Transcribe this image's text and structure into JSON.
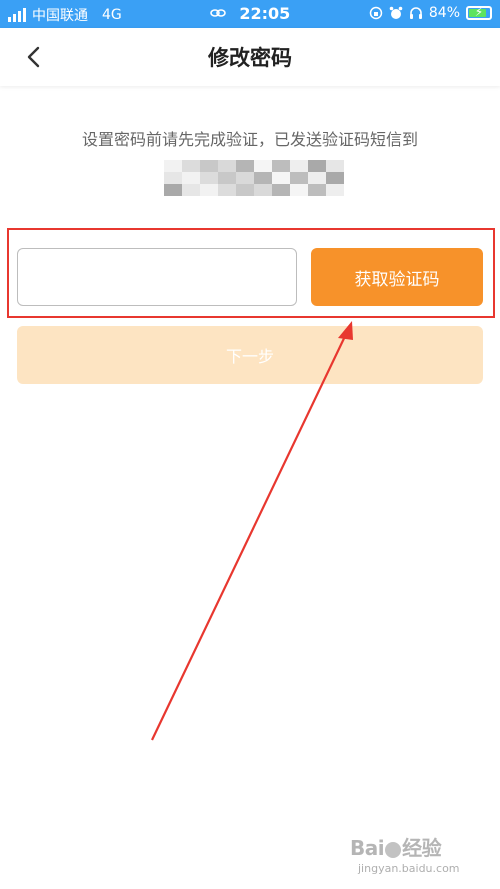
{
  "status_bar": {
    "carrier": "中国联通",
    "network": "4G",
    "time": "22:05",
    "battery": "84%",
    "battery_level": 0.84,
    "icons": [
      "signal-icon",
      "hotspot-icon",
      "lock-rotation-icon",
      "alarm-icon",
      "headphones-icon",
      "battery-icon"
    ]
  },
  "nav": {
    "title": "修改密码",
    "back_icon": "chevron-left-icon"
  },
  "verify": {
    "instruction": "设置密码前请先完成验证，已发送验证码短信到",
    "code_input_value": "",
    "get_code_label": "获取验证码",
    "next_label": "下一步"
  },
  "colors": {
    "status_bar": "#3aa0f5",
    "accent": "#f7922a",
    "accent_disabled": "#fde4c2",
    "annotation": "#e8372f"
  },
  "watermark": {
    "logo": "Bai 经验",
    "url": "jingyan.baidu.com"
  }
}
